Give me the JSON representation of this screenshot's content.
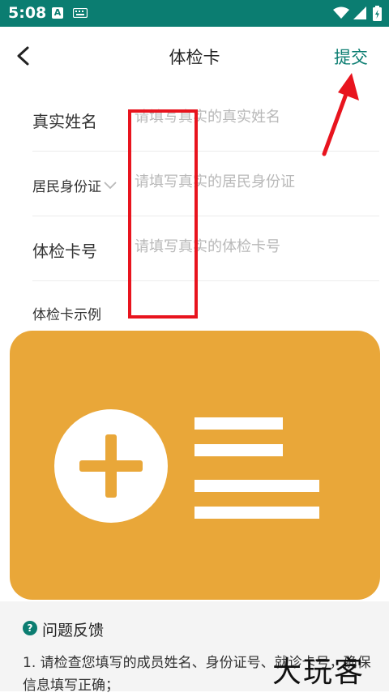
{
  "status_bar": {
    "time": "5:08",
    "icons": [
      "a-notification-icon",
      "keyboard-icon",
      "wifi-icon",
      "signal-icon",
      "battery-icon"
    ]
  },
  "header": {
    "title": "体检卡",
    "submit_label": "提交",
    "back_icon": "back-arrow-icon"
  },
  "form": {
    "name_label": "真实姓名",
    "name_placeholder": "请填写真实的真实姓名",
    "id_type_label": "居民身份证",
    "id_placeholder": "请填写真实的居民身份证",
    "card_label": "体检卡号",
    "card_placeholder": "请填写真实的体检卡号"
  },
  "example": {
    "label": "体检卡示例",
    "image_icon": "medical-card-icon"
  },
  "feedback": {
    "icon_glyph": "?",
    "title": "问题反馈",
    "text": "1. 请检查您填写的成员姓名、身份证号、就诊卡号，确保信息填写正确；"
  },
  "watermark": {
    "text": "大玩客"
  },
  "colors": {
    "accent": "#0b7d71",
    "card": "#e9a739",
    "annotation": "#e8141e",
    "placeholder": "#b8b8b8"
  }
}
